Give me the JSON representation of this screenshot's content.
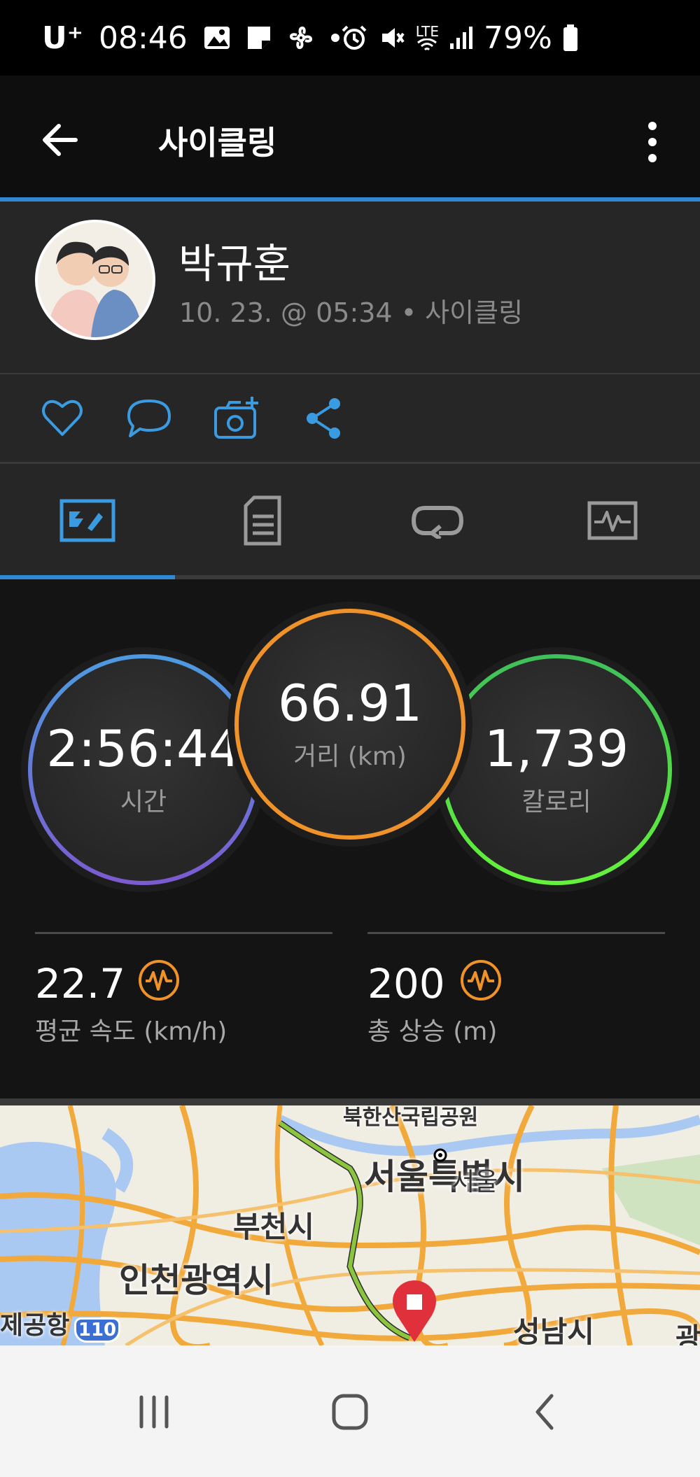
{
  "status_bar": {
    "carrier": "U⁺",
    "time": "08:46",
    "network": "LTE",
    "battery": "79%"
  },
  "app_bar": {
    "title": "사이클링"
  },
  "profile": {
    "name": "박규훈",
    "meta": "10. 23. @ 05:34 • 사이클링"
  },
  "stats": {
    "time": {
      "value": "2:56:44",
      "label": "시간"
    },
    "distance": {
      "value": "66.91",
      "label": "거리 (km)"
    },
    "calories": {
      "value": "1,739",
      "label": "칼로리"
    }
  },
  "metrics": [
    {
      "value": "22.7",
      "label": "평균 속도 (km/h)"
    },
    {
      "value": "200",
      "label": "총 상승 (m)"
    }
  ],
  "map": {
    "labels": {
      "top": "북한산국립공원",
      "seoul_big": "서울특별시",
      "seoul_small": "서울",
      "bucheon": "부천시",
      "incheon": "인천광역시",
      "airport": "제공항",
      "route_no": "110",
      "seongnam": "성남시",
      "edge": "광"
    }
  },
  "colors": {
    "accent_blue": "#2f88d4",
    "ring_orange": "#f0922a",
    "ring_green": "#4cd94c",
    "ring_blue_purple": "#5c8fd6"
  }
}
